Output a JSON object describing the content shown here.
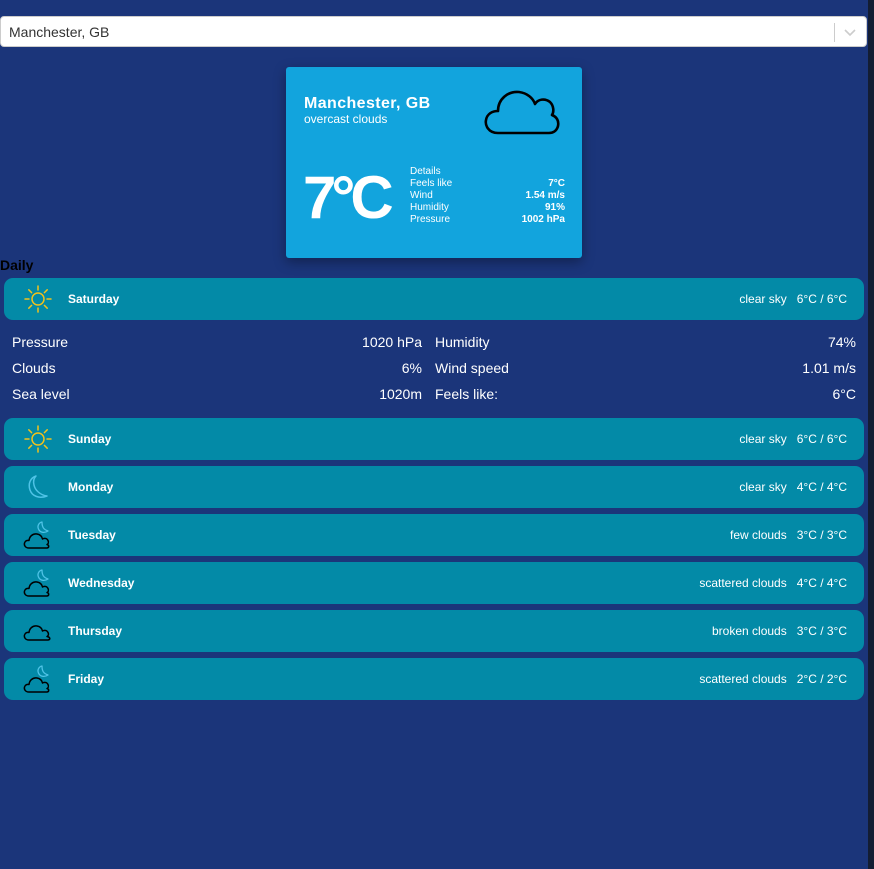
{
  "search": {
    "value": "Manchester, GB"
  },
  "current": {
    "city": "Manchester, GB",
    "description": "overcast clouds",
    "temperature": "7°C",
    "icon": "cloud-icon",
    "details_title": "Details",
    "details": [
      {
        "label": "Feels like",
        "value": "7°C"
      },
      {
        "label": "Wind",
        "value": "1.54 m/s"
      },
      {
        "label": "Humidity",
        "value": "91%"
      },
      {
        "label": "Pressure",
        "value": "1002 hPa"
      }
    ]
  },
  "daily": {
    "title": "Daily",
    "days": [
      {
        "name": "Saturday",
        "description": "clear sky",
        "temp": "6°C / 6°C",
        "icon": "sun-icon"
      },
      {
        "name": "Sunday",
        "description": "clear sky",
        "temp": "6°C / 6°C",
        "icon": "sun-icon"
      },
      {
        "name": "Monday",
        "description": "clear sky",
        "temp": "4°C / 4°C",
        "icon": "moon-icon"
      },
      {
        "name": "Tuesday",
        "description": "few clouds",
        "temp": "3°C / 3°C",
        "icon": "cloud-moon-icon"
      },
      {
        "name": "Wednesday",
        "description": "scattered clouds",
        "temp": "4°C / 4°C",
        "icon": "cloud-moon-icon"
      },
      {
        "name": "Thursday",
        "description": "broken clouds",
        "temp": "3°C / 3°C",
        "icon": "cloud-icon"
      },
      {
        "name": "Friday",
        "description": "scattered clouds",
        "temp": "2°C / 2°C",
        "icon": "cloud-moon-icon"
      }
    ],
    "expanded": [
      {
        "label_left": "Pressure",
        "value_left": "1020 hPa",
        "label_right": "Humidity",
        "value_right": "74%"
      },
      {
        "label_left": "Clouds",
        "value_left": "6%",
        "label_right": "Wind speed",
        "value_right": "1.01 m/s"
      },
      {
        "label_left": "Sea level",
        "value_left": "1020m",
        "label_right": "Feels like:",
        "value_right": "6°C"
      }
    ]
  },
  "colors": {
    "background": "#1b357a",
    "card": "#12a4dd",
    "row": "#038aa7",
    "sun": "#f2c21b",
    "moon": "#4fc3e6"
  }
}
